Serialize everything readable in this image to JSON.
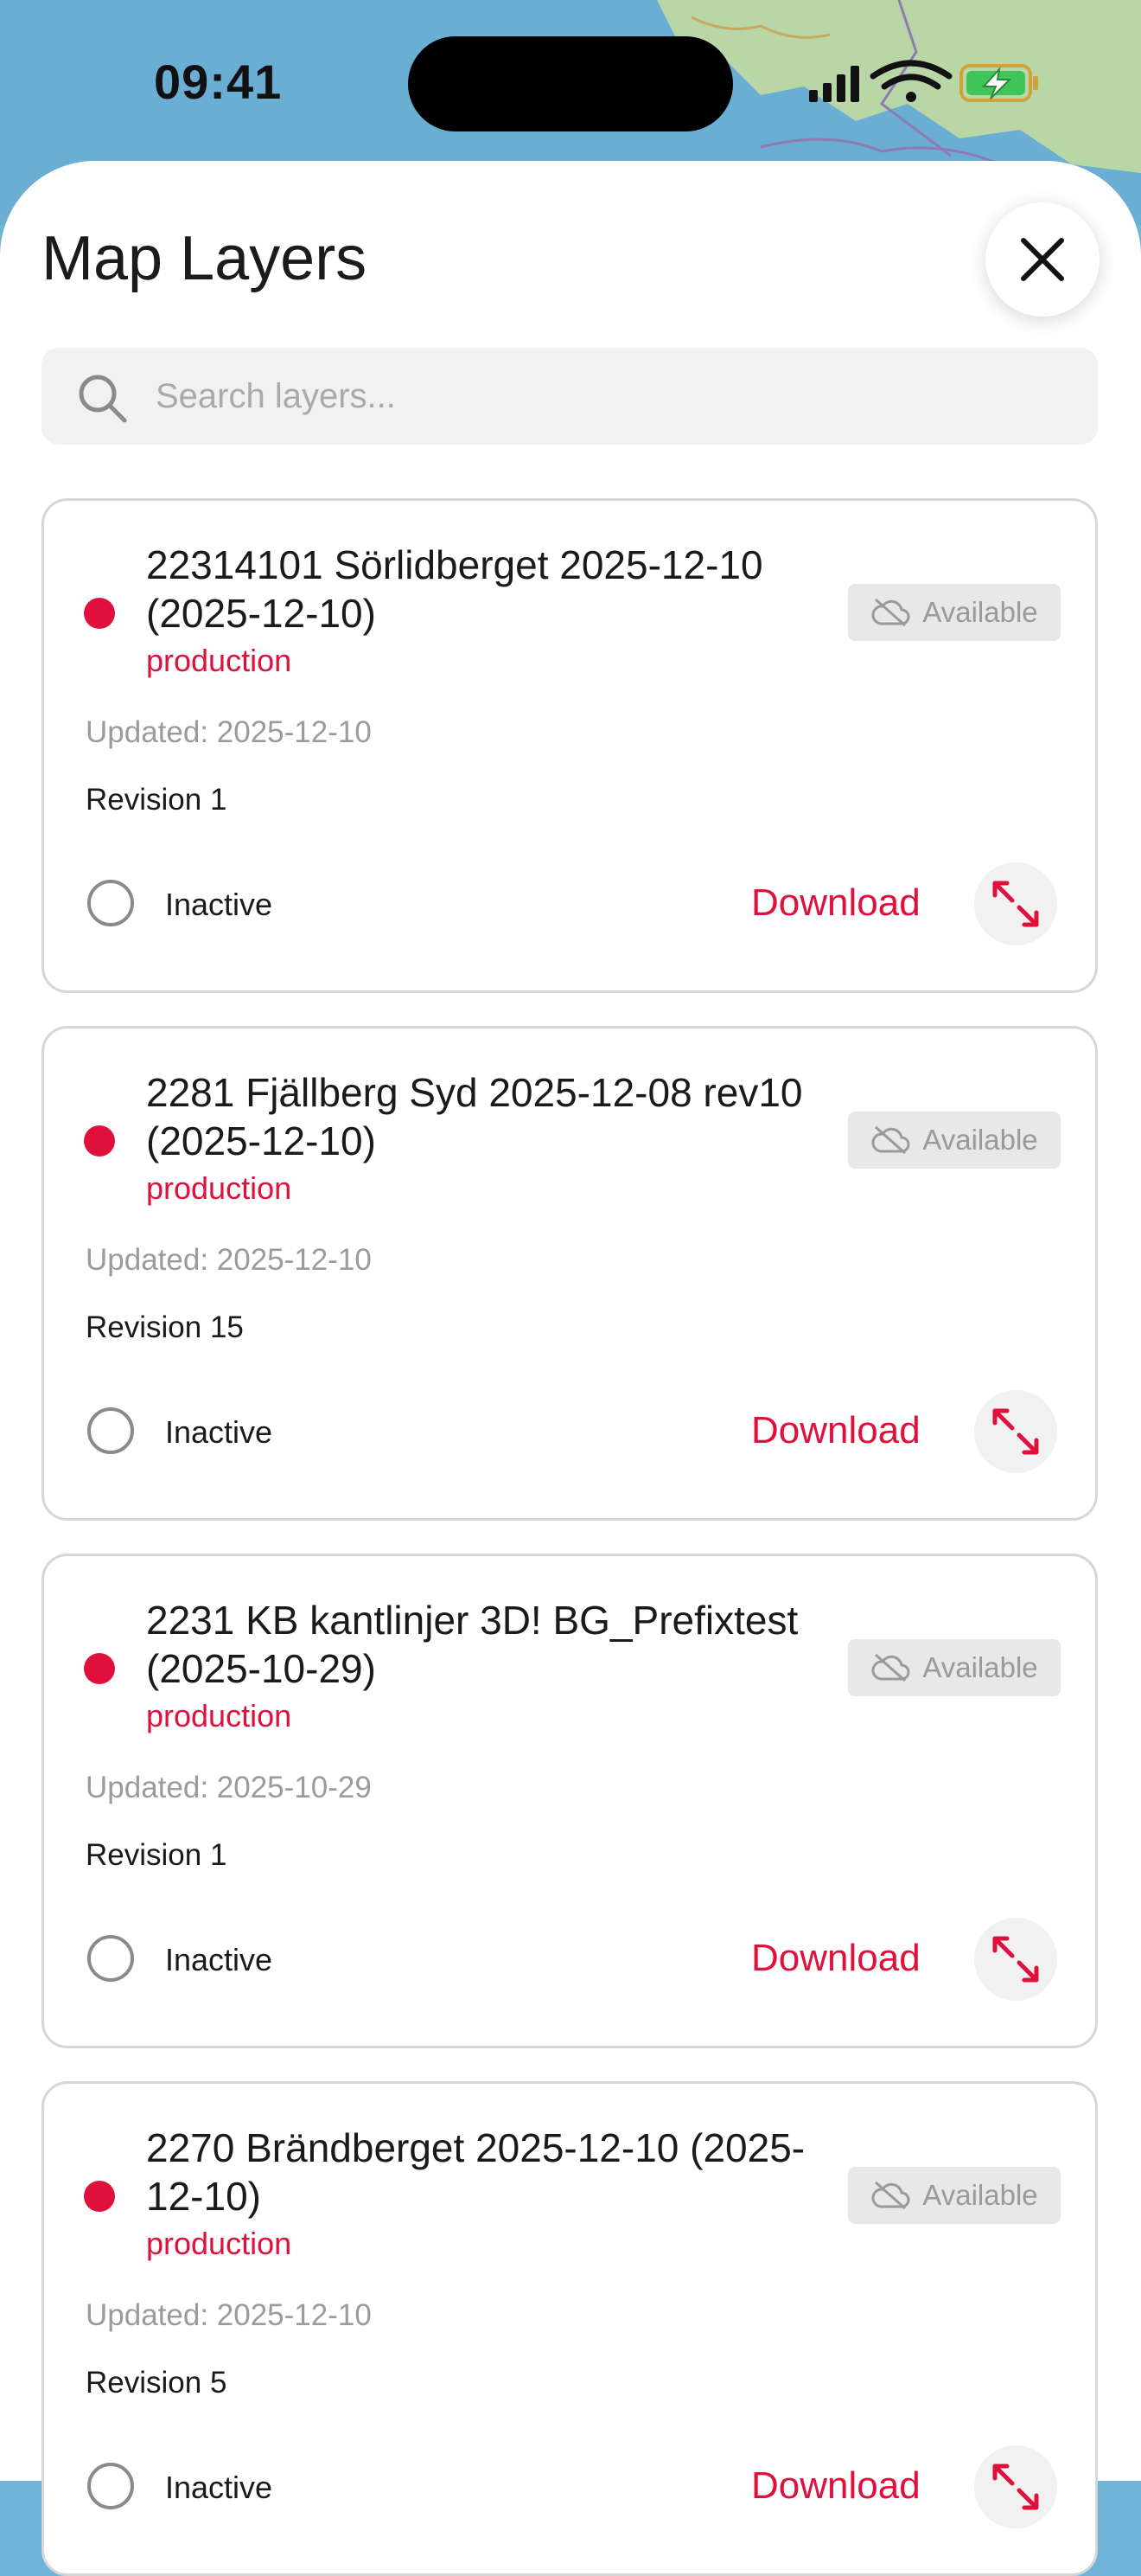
{
  "status_bar": {
    "time": "09:41"
  },
  "header": {
    "title": "Map Layers"
  },
  "search": {
    "placeholder": "Search layers..."
  },
  "colors": {
    "accent": "#e0103c",
    "badge_bg": "#e8e8e8",
    "border": "#d6d6d6"
  },
  "icons": {
    "search": "search-icon",
    "close": "close-icon",
    "cloud": "cloud-off-icon",
    "expand": "expand-icon"
  },
  "layers": [
    {
      "title": "22314101 Sörlidberget 2025-12-10 (2025-12-10)",
      "environment": "production",
      "badge": "Available",
      "updated": "Updated: 2025-12-10",
      "revision": "Revision 1",
      "state": "Inactive",
      "action": "Download"
    },
    {
      "title": "2281 Fjällberg Syd 2025-12-08 rev10 (2025-12-10)",
      "environment": "production",
      "badge": "Available",
      "updated": "Updated: 2025-12-10",
      "revision": "Revision 15",
      "state": "Inactive",
      "action": "Download"
    },
    {
      "title": "2231 KB kantlinjer 3D! BG_Prefixtest (2025-10-29)",
      "environment": "production",
      "badge": "Available",
      "updated": "Updated: 2025-10-29",
      "revision": "Revision 1",
      "state": "Inactive",
      "action": "Download"
    },
    {
      "title": "2270 Brändberget 2025-12-10 (2025-12-10)",
      "environment": "production",
      "badge": "Available",
      "updated": "Updated: 2025-12-10",
      "revision": "Revision 5",
      "state": "Inactive",
      "action": "Download"
    }
  ]
}
